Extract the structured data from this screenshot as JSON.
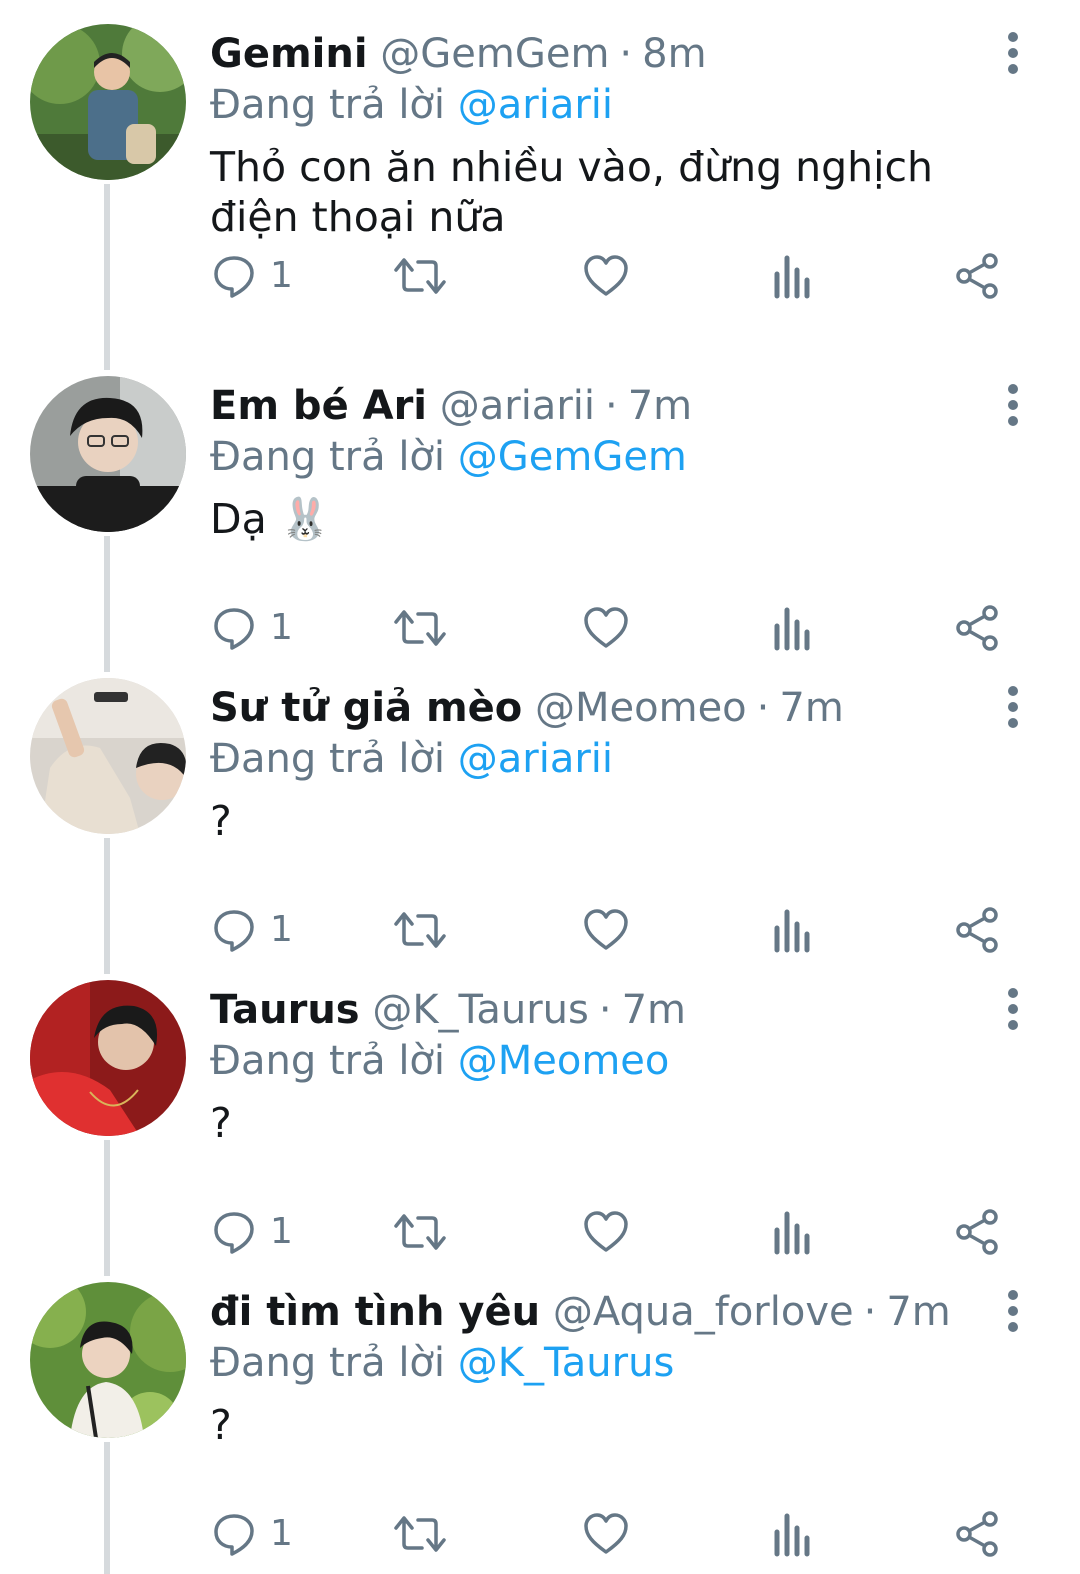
{
  "tweets": [
    {
      "display_name": "Gemini",
      "handle": "@GemGem",
      "separator": "·",
      "time": "8m",
      "reply_prefix": "Đang trả lời",
      "reply_to": "@ariarii",
      "text": "Thỏ con ăn nhiều vào, đừng nghịch điện thoại nữa",
      "reply_count": "1"
    },
    {
      "display_name": "Em bé Ari",
      "handle": "@ariarii",
      "separator": "·",
      "time": "7m",
      "reply_prefix": "Đang trả lời",
      "reply_to": "@GemGem",
      "text": "Dạ 🐰",
      "reply_count": "1"
    },
    {
      "display_name": "Sư tử giả mèo",
      "handle": "@Meomeo",
      "separator": "·",
      "time": "7m",
      "reply_prefix": "Đang trả lời",
      "reply_to": "@ariarii",
      "text": "?",
      "reply_count": "1"
    },
    {
      "display_name": "Taurus",
      "handle": "@K_Taurus",
      "separator": "·",
      "time": "7m",
      "reply_prefix": "Đang trả lời",
      "reply_to": "@Meomeo",
      "text": "?",
      "reply_count": "1"
    },
    {
      "display_name": "đi tìm tình yêu",
      "handle": "@Aqua_forlove",
      "separator": "·",
      "time": "7m",
      "reply_prefix": "Đang trả lời",
      "reply_to": "@K_Taurus",
      "text": "?",
      "reply_count": "1"
    }
  ],
  "icons": {
    "reply": "reply-icon",
    "retweet": "retweet-icon",
    "like": "heart-icon",
    "analytics": "analytics-icon",
    "share": "share-icon",
    "more": "more-vertical-icon"
  },
  "colors": {
    "text": "#14171a",
    "secondary": "#657786",
    "link": "#1da1f2",
    "thread_line": "#d6dadd"
  }
}
